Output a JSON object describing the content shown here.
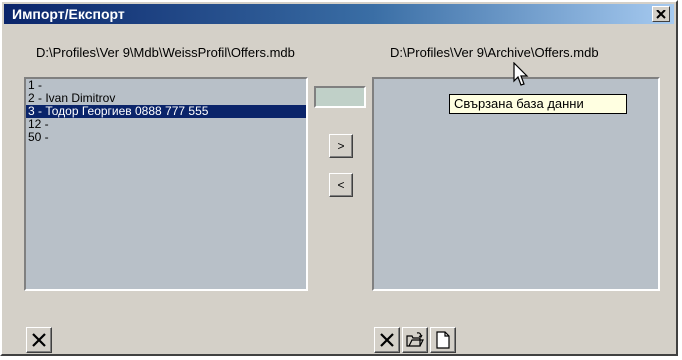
{
  "window": {
    "title": "Импорт/Експорт",
    "close_glyph": "✕"
  },
  "paths": {
    "source": "D:\\Profiles\\Ver 9\\Mdb\\WeissProfil\\Offers.mdb",
    "target": "D:\\Profiles\\Ver 9\\Archive\\Offers.mdb"
  },
  "left_list": {
    "items": [
      {
        "label": "1 -",
        "selected": false
      },
      {
        "label": "2 - Ivan Dimitrov",
        "selected": false
      },
      {
        "label": "3 - Тодор Георгиев 0888 777 555",
        "selected": true
      },
      {
        "label": "12 -",
        "selected": false
      },
      {
        "label": "50 -",
        "selected": false
      }
    ]
  },
  "transfer": {
    "move_right_label": ">",
    "move_left_label": "<",
    "counter_value": ""
  },
  "tooltip": {
    "text": "Свързана база данни"
  },
  "toolbar_left": {
    "delete_icon": "delete-x-icon"
  },
  "toolbar_right": {
    "delete_icon": "delete-x-icon",
    "open_icon": "open-folder-icon",
    "new_icon": "new-document-icon"
  },
  "colors": {
    "face": "#d4d0c8",
    "title_active": "#0a246a",
    "list_background": "#b8c0c8",
    "selection": "#0a246a",
    "tooltip_background": "#ffffe1"
  }
}
